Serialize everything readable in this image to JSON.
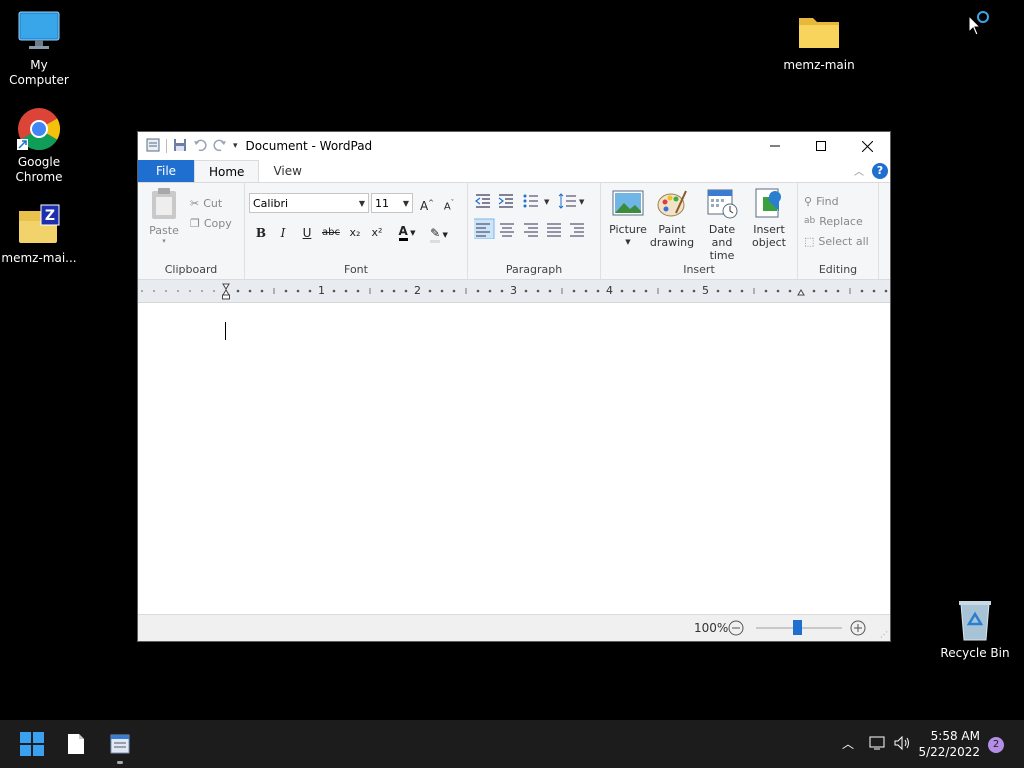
{
  "desktop": {
    "icons": [
      {
        "label": "My Computer"
      },
      {
        "label": "Google Chrome"
      },
      {
        "label": "memz-mai..."
      },
      {
        "label": "memz-main"
      },
      {
        "label": "Recycle Bin"
      }
    ]
  },
  "window": {
    "title": "Document - WordPad",
    "tabs": {
      "file": "File",
      "home": "Home",
      "view": "View"
    },
    "help": "?",
    "clipboard": {
      "paste": "Paste",
      "cut": "Cut",
      "copy": "Copy",
      "label": "Clipboard"
    },
    "font": {
      "family": "Calibri",
      "size": "11",
      "label": "Font",
      "bold": "B",
      "italic": "I",
      "underline": "U",
      "strike": "abc",
      "subscript": "x₂",
      "superscript": "x²",
      "color_glyph": "A"
    },
    "paragraph": {
      "label": "Paragraph"
    },
    "insert": {
      "picture": "Picture",
      "paint_l1": "Paint",
      "paint_l2": "drawing",
      "date_l1": "Date and",
      "date_l2": "time",
      "object_l1": "Insert",
      "object_l2": "object",
      "label": "Insert"
    },
    "editing": {
      "find": "Find",
      "replace": "Replace",
      "select_all": "Select all",
      "label": "Editing"
    },
    "ruler_numbers": [
      "1",
      "2",
      "3",
      "4",
      "5"
    ],
    "status": {
      "zoom": "100%",
      "zoom_level": 100
    }
  },
  "taskbar": {
    "time": "5:58 AM",
    "date": "5/22/2022",
    "notifications": "2"
  },
  "colors": {
    "accent": "#1e6fd0",
    "taskbar": "#1c1c1c",
    "desktop": "#000000"
  }
}
